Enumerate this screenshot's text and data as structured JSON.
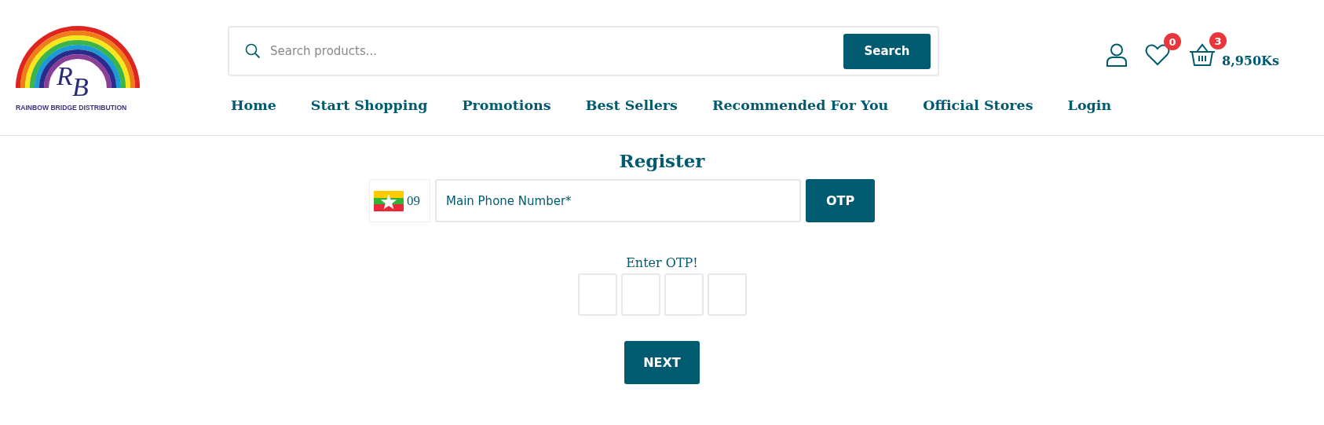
{
  "logo": {
    "monogram_1": "R",
    "monogram_2": "B",
    "name": "RAINBOW BRIDGE DISTRIBUTION"
  },
  "search": {
    "placeholder": "Search products...",
    "button": "Search"
  },
  "header_icons": {
    "wishlist_count": "0",
    "cart_count": "3",
    "cart_total": "8,950Ks"
  },
  "nav": [
    {
      "label": "Home"
    },
    {
      "label": "Start Shopping"
    },
    {
      "label": "Promotions"
    },
    {
      "label": "Best Sellers"
    },
    {
      "label": "Recommended For You"
    },
    {
      "label": "Official Stores"
    },
    {
      "label": "Login"
    }
  ],
  "register": {
    "title": "Register",
    "country_code": "09",
    "phone_placeholder": "Main Phone Number*",
    "otp_button": "OTP",
    "otp_label": "Enter OTP!",
    "next_button": "NEXT"
  }
}
